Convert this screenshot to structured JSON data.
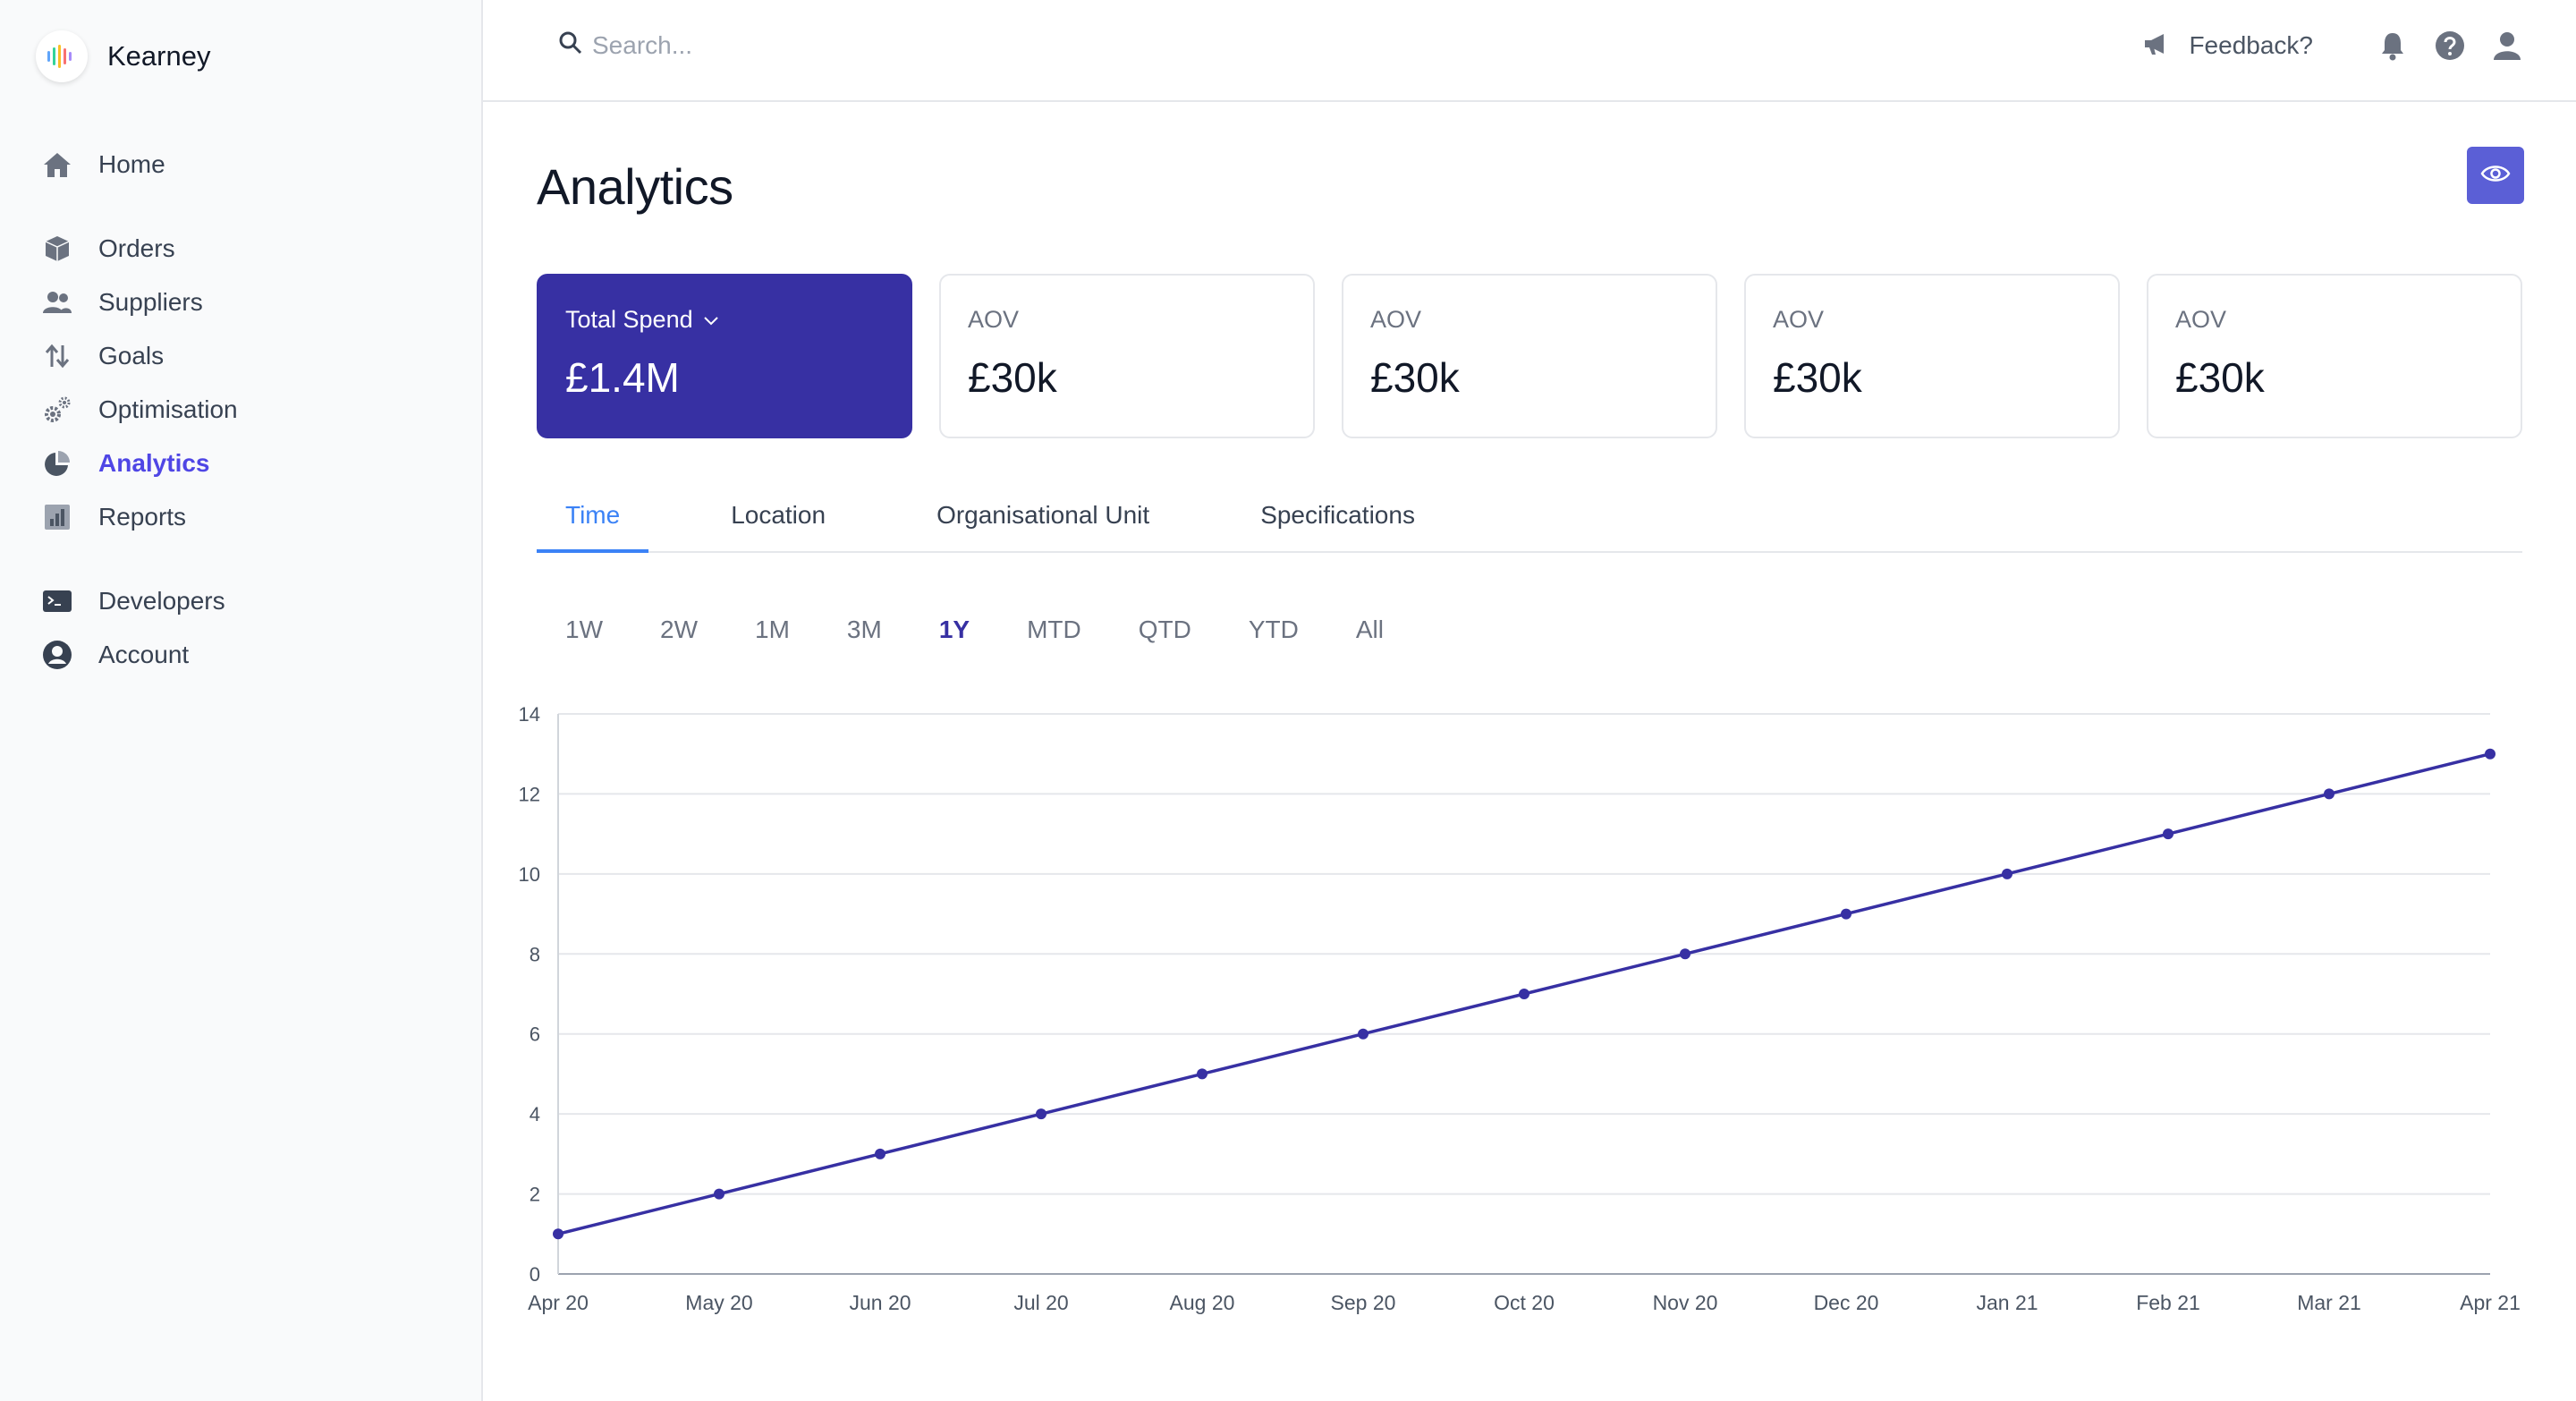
{
  "brand": {
    "name": "Kearney"
  },
  "sidebar": {
    "groups": [
      [
        {
          "label": "Home",
          "icon": "home-icon"
        }
      ],
      [
        {
          "label": "Orders",
          "icon": "box-icon"
        },
        {
          "label": "Suppliers",
          "icon": "users-icon"
        },
        {
          "label": "Goals",
          "icon": "arrows-icon"
        },
        {
          "label": "Optimisation",
          "icon": "cog-icon"
        },
        {
          "label": "Analytics",
          "icon": "pie-chart-icon",
          "active": true
        },
        {
          "label": "Reports",
          "icon": "report-icon"
        }
      ],
      [
        {
          "label": "Developers",
          "icon": "terminal-icon"
        },
        {
          "label": "Account",
          "icon": "account-icon"
        }
      ]
    ]
  },
  "topbar": {
    "search_placeholder": "Search...",
    "feedback_label": "Feedback?"
  },
  "page": {
    "title": "Analytics"
  },
  "cards": [
    {
      "label": "Total Spend",
      "value": "£1.4M",
      "dropdown": true
    },
    {
      "label": "AOV",
      "value": "£30k"
    },
    {
      "label": "AOV",
      "value": "£30k"
    },
    {
      "label": "AOV",
      "value": "£30k"
    },
    {
      "label": "AOV",
      "value": "£30k"
    }
  ],
  "tabs": [
    "Time",
    "Location",
    "Organisational Unit",
    "Specifications"
  ],
  "active_tab": "Time",
  "ranges": [
    "1W",
    "2W",
    "1M",
    "3M",
    "1Y",
    "MTD",
    "QTD",
    "YTD",
    "All"
  ],
  "active_range": "1Y",
  "colors": {
    "accent": "#3730a3",
    "tab_active": "#3b82f6",
    "button": "#5b5fd6"
  },
  "chart_data": {
    "type": "line",
    "categories": [
      "Apr 20",
      "May 20",
      "Jun 20",
      "Jul 20",
      "Aug 20",
      "Sep 20",
      "Oct 20",
      "Nov 20",
      "Dec 20",
      "Jan 21",
      "Feb 21",
      "Mar 21",
      "Apr 21"
    ],
    "series": [
      {
        "values": [
          1,
          2,
          3,
          4,
          5,
          6,
          7,
          8,
          9,
          10,
          11,
          12,
          13
        ]
      }
    ],
    "ylim": [
      0,
      14
    ],
    "yticks": [
      0,
      2,
      4,
      6,
      8,
      10,
      12,
      14
    ],
    "grid": true,
    "line_color": "#3730a3"
  }
}
